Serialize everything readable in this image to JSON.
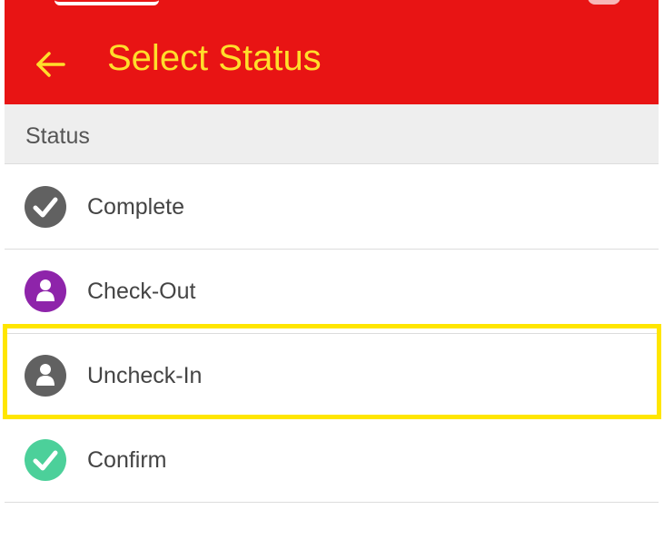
{
  "appbar": {
    "title": "Select Status",
    "background_color": "#e81414",
    "title_color": "#ffde2b",
    "back_icon": "arrow-left-icon"
  },
  "section_header": {
    "label": "Status"
  },
  "statuses": [
    {
      "label": "Complete",
      "icon": "check-circle-icon",
      "color": "#616161"
    },
    {
      "label": "Check-Out",
      "icon": "person-circle-icon",
      "color": "#8e24aa"
    },
    {
      "label": "Uncheck-In",
      "icon": "person-circle-icon",
      "color": "#616161"
    },
    {
      "label": "Confirm",
      "icon": "check-circle-icon",
      "color": "#4cd09a"
    }
  ],
  "highlight": {
    "color": "#ffe600",
    "target": "Uncheck-In"
  }
}
